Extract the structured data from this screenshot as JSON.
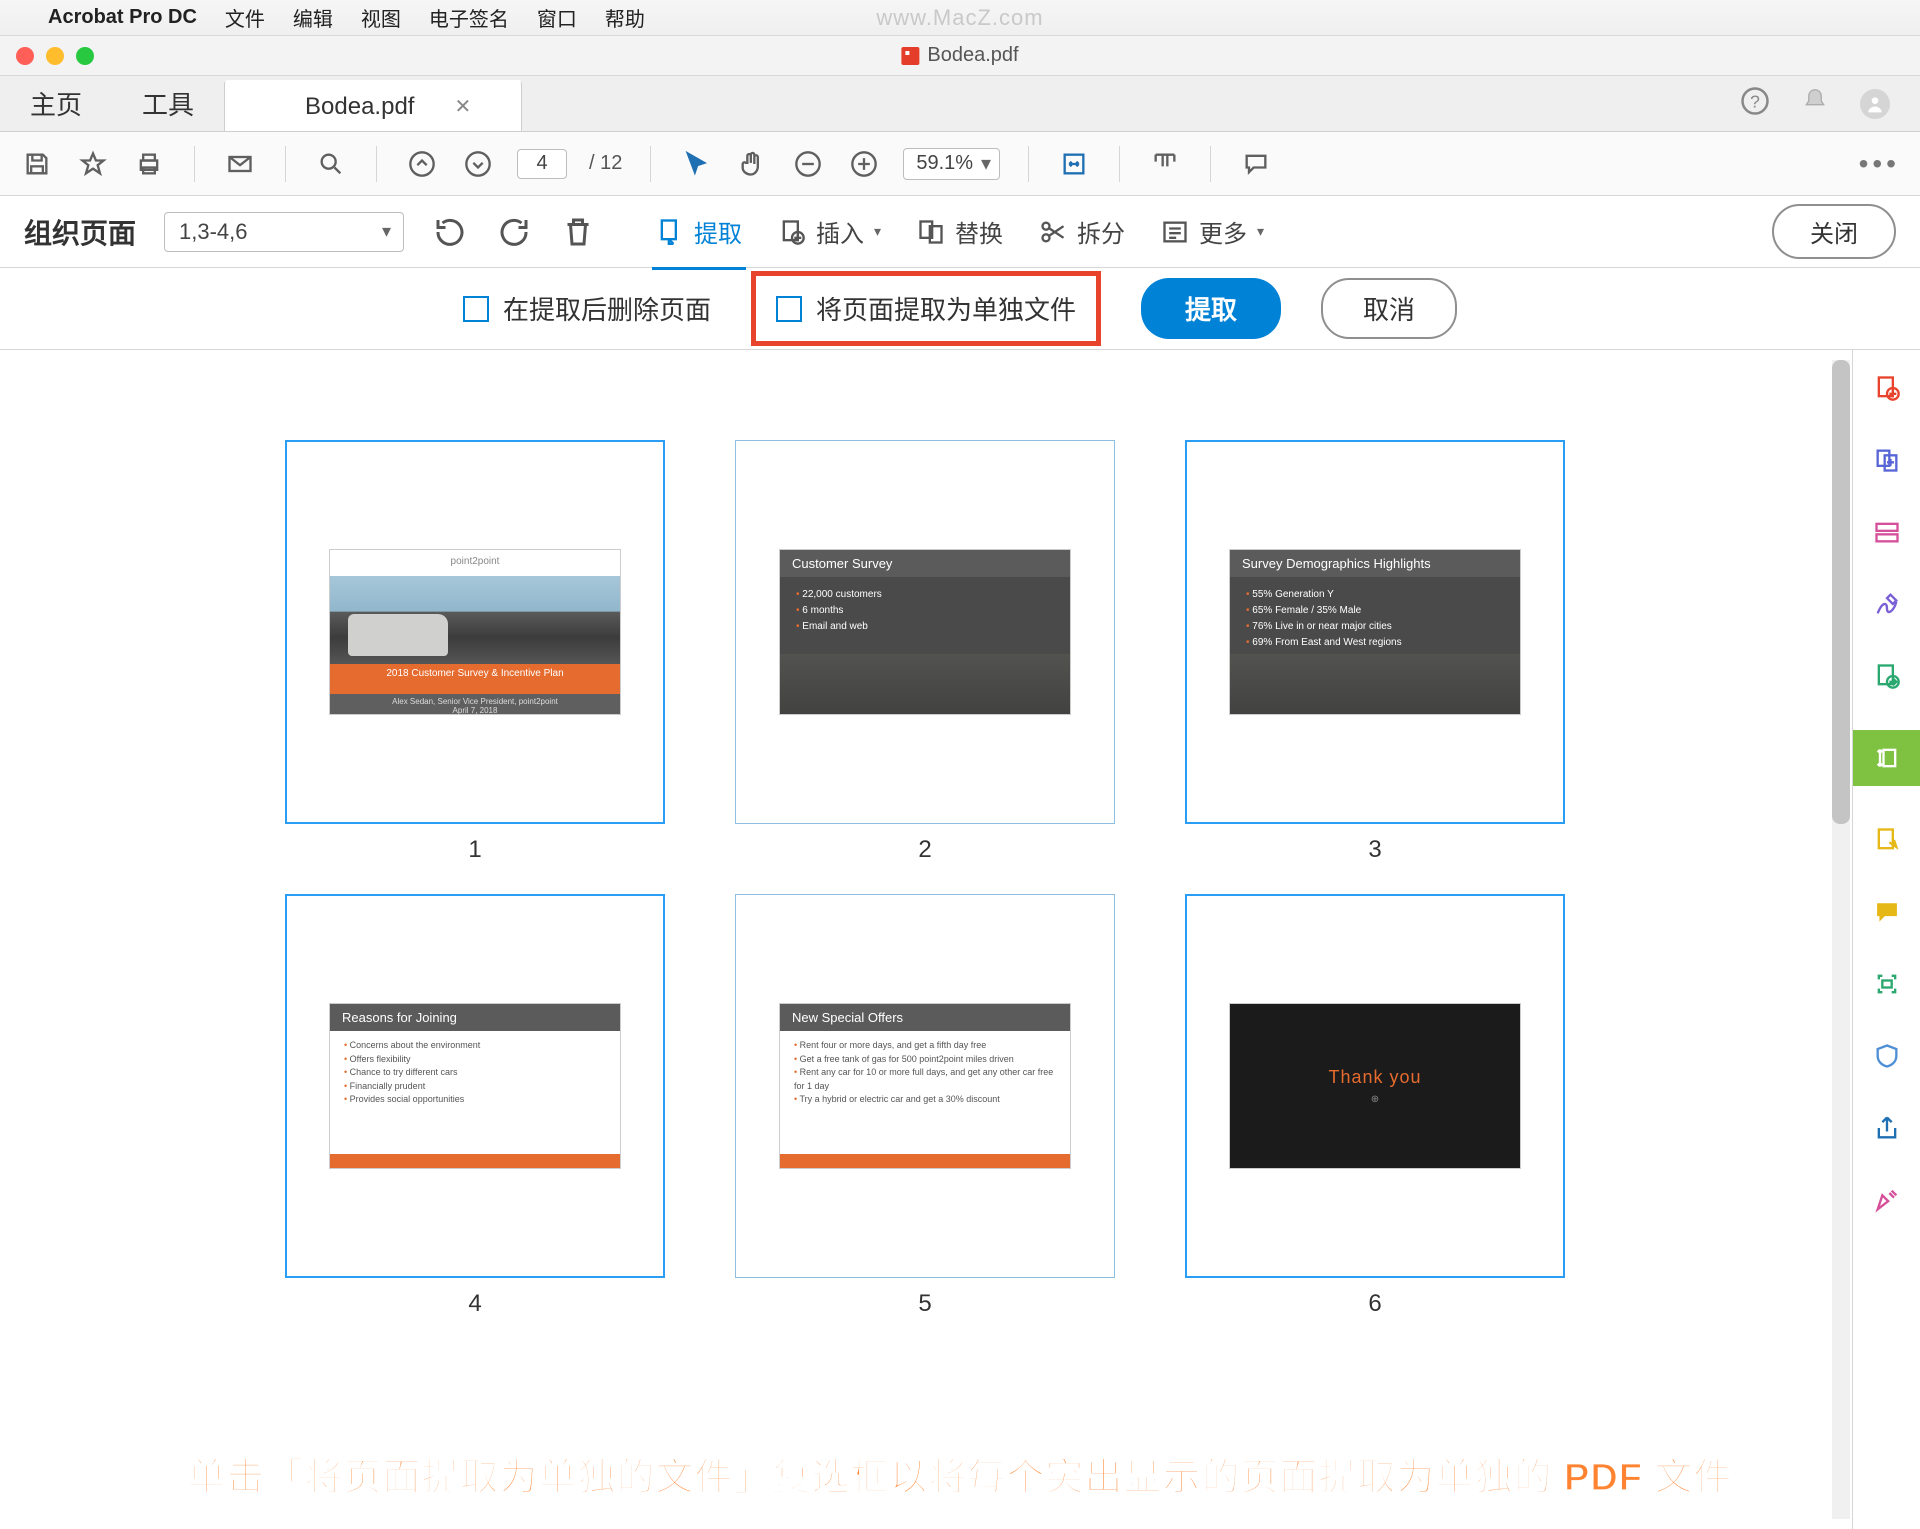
{
  "menubar": {
    "app_name": "Acrobat Pro DC",
    "items": [
      "文件",
      "编辑",
      "视图",
      "电子签名",
      "窗口",
      "帮助"
    ],
    "watermark": "www.MacZ.com"
  },
  "window": {
    "title": "Bodea.pdf"
  },
  "tabs": {
    "home": "主页",
    "tools": "工具",
    "active": "Bodea.pdf"
  },
  "toolbar": {
    "page_current": "4",
    "page_total": "/ 12",
    "zoom": "59.1%"
  },
  "organize": {
    "title": "组织页面",
    "range": "1,3-4,6",
    "extract": "提取",
    "insert": "插入",
    "replace": "替换",
    "split": "拆分",
    "more": "更多",
    "close": "关闭"
  },
  "extract_bar": {
    "delete_after": "在提取后删除页面",
    "separate_files": "将页面提取为单独文件",
    "extract_btn": "提取",
    "cancel_btn": "取消"
  },
  "thumbs": [
    {
      "num": "1",
      "sel": true,
      "kind": "cover",
      "title": "2018 Customer Survey & Incentive Plan",
      "sub": "Alex Sedan, Senior Vice President, point2point",
      "date": "April 7, 2018",
      "brand": "point2point"
    },
    {
      "num": "2",
      "sel": false,
      "kind": "survey",
      "title": "Customer Survey",
      "bullets": [
        "22,000 customers",
        "6 months",
        "Email and web"
      ]
    },
    {
      "num": "3",
      "sel": true,
      "kind": "demo",
      "title": "Survey Demographics Highlights",
      "bullets": [
        "55% Generation Y",
        "65% Female / 35% Male",
        "76% Live in or near major cities",
        "69% From East and West regions"
      ]
    },
    {
      "num": "4",
      "sel": true,
      "kind": "reasons",
      "title": "Reasons for Joining",
      "bullets": [
        "Concerns about the environment",
        "Offers flexibility",
        "Chance to try different cars",
        "Financially prudent",
        "Provides social opportunities"
      ]
    },
    {
      "num": "5",
      "sel": false,
      "kind": "offers",
      "title": "New Special Offers",
      "bullets": [
        "Rent four or more days, and get a fifth day free",
        "Get a free tank of gas for 500 point2point miles driven",
        "Rent any car for 10 or more full days, and get any other car free for 1 day",
        "Try a hybrid or electric car and get a 30% discount"
      ]
    },
    {
      "num": "6",
      "sel": true,
      "kind": "thanks",
      "title": "Thank you"
    }
  ],
  "instruction": "单击「将页面提取为单独的文件」复选框以将每个突出显示的页面提取为单独的 PDF 文件"
}
